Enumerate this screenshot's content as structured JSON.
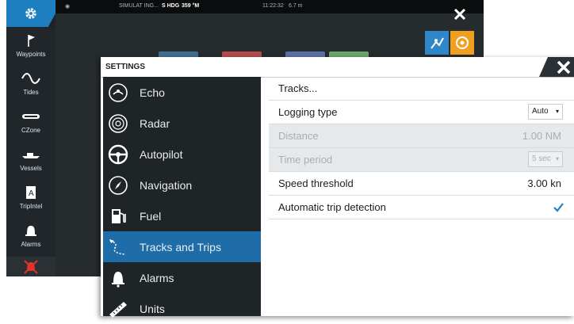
{
  "statusbar": {
    "source": "SIMULAT ING...",
    "hdg_label": "S HDG",
    "hdg_value": "359 °M",
    "time": "11:22:32",
    "distance": "6.7 m"
  },
  "sidebar": {
    "items": [
      {
        "label": "Waypoints",
        "icon": "flag-icon"
      },
      {
        "label": "Tides",
        "icon": "tide-wave-icon"
      },
      {
        "label": "CZone",
        "icon": "czone-icon"
      },
      {
        "label": "Vessels",
        "icon": "vessel-icon"
      },
      {
        "label": "TripIntel",
        "icon": "tripintel-icon"
      },
      {
        "label": "Alarms",
        "icon": "bell-icon"
      }
    ]
  },
  "settings": {
    "title": "SETTINGS",
    "categories": [
      {
        "label": "Echo",
        "icon": "echo-icon"
      },
      {
        "label": "Radar",
        "icon": "radar-icon"
      },
      {
        "label": "Autopilot",
        "icon": "steering-wheel-icon"
      },
      {
        "label": "Navigation",
        "icon": "compass-icon"
      },
      {
        "label": "Fuel",
        "icon": "fuel-pump-icon"
      },
      {
        "label": "Tracks and Trips",
        "icon": "tracks-icon",
        "active": true
      },
      {
        "label": "Alarms",
        "icon": "bell-icon"
      },
      {
        "label": "Units",
        "icon": "ruler-icon"
      }
    ],
    "options": {
      "tracks": {
        "label": "Tracks..."
      },
      "logging_type": {
        "label": "Logging type",
        "value": "Auto"
      },
      "distance": {
        "label": "Distance",
        "value": "1.00 NM"
      },
      "time_period": {
        "label": "Time period",
        "value": "5 sec"
      },
      "speed_threshold": {
        "label": "Speed threshold",
        "value": "3.00 kn"
      },
      "auto_trip": {
        "label": "Automatic trip detection",
        "checked": true
      }
    }
  },
  "colors": {
    "accent": "#1d7fc0",
    "active_category": "#1e6da8",
    "panel_dark": "#1f2427",
    "alarm_red": "#e0332c"
  }
}
